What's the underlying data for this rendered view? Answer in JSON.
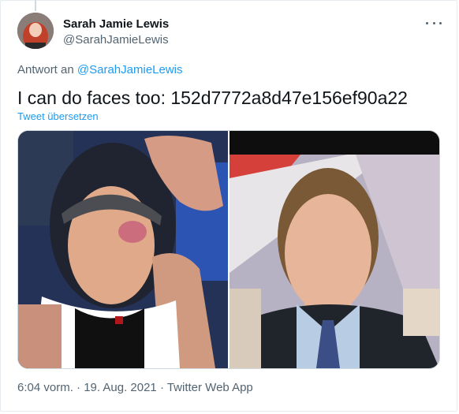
{
  "tweet": {
    "author_name": "Sarah Jamie Lewis",
    "author_handle": "@SarahJamieLewis",
    "reply_prefix": "Antwort an",
    "reply_to": "@SarahJamieLewis",
    "text": "I can do faces too: 152d7772a8d47e156ef90a22",
    "translate_label": "Tweet übersetzen",
    "timestamp": "6:04 vorm. · 19. Aug. 2021 · Twitter Web App"
  },
  "colors": {
    "link": "#1d9bf0",
    "secondary_text": "#536471",
    "primary_text": "#0f1419"
  },
  "icons": {
    "more": "more-options-icon"
  }
}
